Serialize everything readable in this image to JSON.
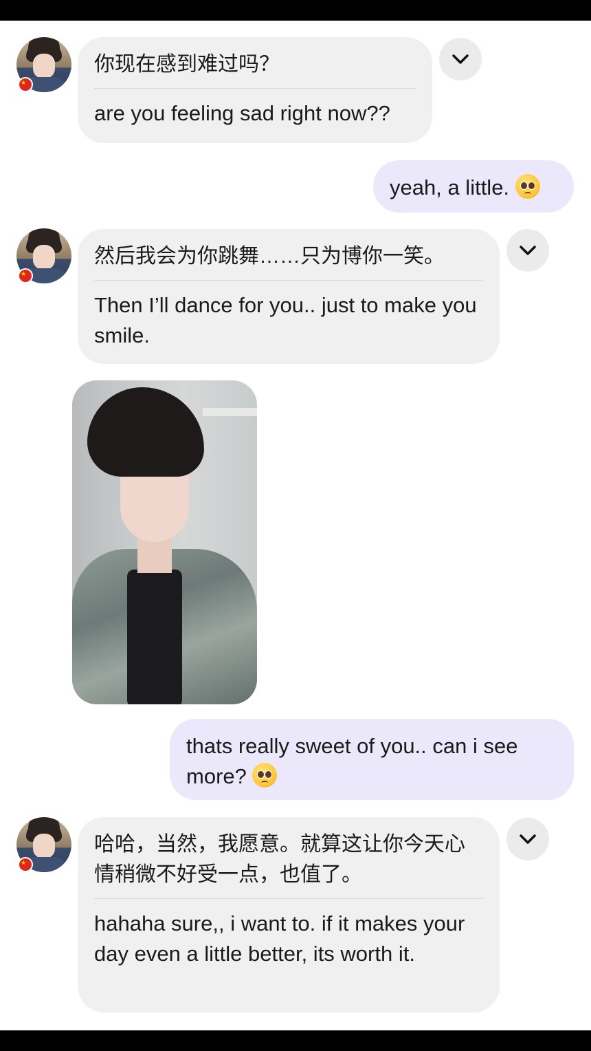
{
  "messages": {
    "m1": {
      "zh": "你现在感到难过吗？",
      "en": "are you feeling sad right now??"
    },
    "m2": {
      "text": "yeah, a little."
    },
    "m3": {
      "zh": "然后我会为你跳舞……只为博你一笑。",
      "en": "Then I’ll dance for you.. just to make you smile."
    },
    "m4": {
      "text": "thats really sweet of you.. can i see more?"
    },
    "m5": {
      "zh": "哈哈，当然，我愿意。就算这让你今天心情稍微不好受一点，也值了。",
      "en": "hahaha sure,, i want to. if it makes your day even a little better, its worth it."
    }
  },
  "icons": {
    "chevron": "chevron-down-icon",
    "emoji": "pleading-face-emoji",
    "flag": "china-flag-icon"
  },
  "colors": {
    "incoming_bubble": "#f0f0f0",
    "outgoing_bubble": "#ebe8fb",
    "bars": "#000000"
  }
}
